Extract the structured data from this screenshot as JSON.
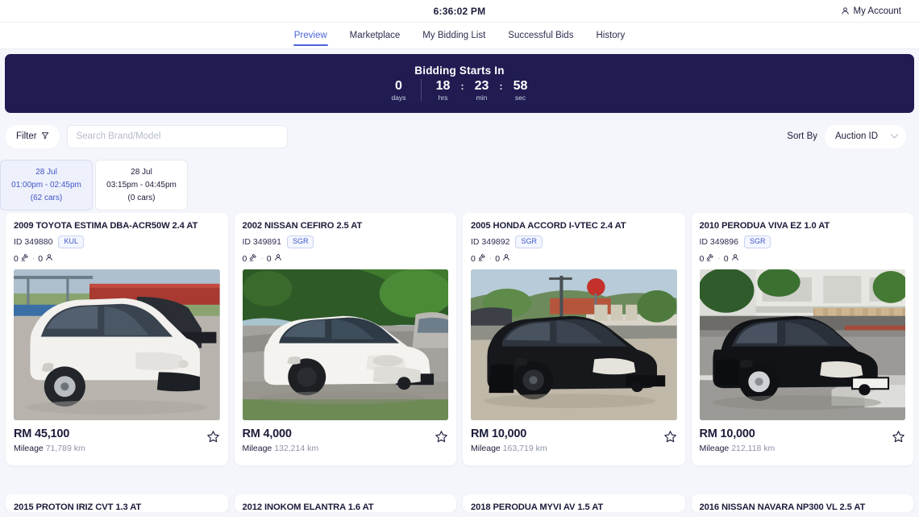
{
  "header": {
    "clock": "6:36:02 PM",
    "account_label": "My Account",
    "account_icon": "person-icon"
  },
  "nav": {
    "items": [
      {
        "label": "Preview",
        "active": true
      },
      {
        "label": "Marketplace",
        "active": false
      },
      {
        "label": "My Bidding List",
        "active": false
      },
      {
        "label": "Successful Bids",
        "active": false
      },
      {
        "label": "History",
        "active": false
      }
    ]
  },
  "countdown": {
    "title": "Bidding Starts In",
    "days": "0",
    "days_label": "days",
    "hrs": "18",
    "hrs_label": "hrs",
    "min": "23",
    "min_label": "min",
    "sec": "58",
    "sec_label": "sec",
    "separator": ":",
    "background": "#201c52"
  },
  "toolbar": {
    "filter_label": "Filter",
    "filter_icon": "funnel-icon",
    "search_placeholder": "Search Brand/Model",
    "search_value": "",
    "sort_label": "Sort By",
    "sort_value": "Auction ID",
    "sort_options": [
      "Auction ID"
    ],
    "chevron_icon": "chevron-down-icon"
  },
  "sessions": [
    {
      "date": "28 Jul",
      "time": "01:00pm - 02:45pm",
      "cars": "(62 cars)",
      "active": true
    },
    {
      "date": "28 Jul",
      "time": "03:15pm - 04:45pm",
      "cars": "(0 cars)",
      "active": false
    }
  ],
  "cards": [
    {
      "title": "2009 TOYOTA ESTIMA DBA-ACR50W 2.4 AT",
      "id": "ID 349880",
      "location": "KUL",
      "bids": "0",
      "watchers": "0",
      "price": "RM 45,100",
      "mileage_label": "Mileage",
      "mileage_value": "71,789 km",
      "photo": "white-mpv-toyota-estima",
      "favorite": false
    },
    {
      "title": "2002 NISSAN CEFIRO 2.5 AT",
      "id": "ID 349891",
      "location": "SGR",
      "bids": "0",
      "watchers": "0",
      "price": "RM 4,000",
      "mileage_label": "Mileage",
      "mileage_value": "132,214 km",
      "photo": "white-sedan-nissan-cefiro",
      "favorite": false
    },
    {
      "title": "2005 HONDA ACCORD I-VTEC 2.4 AT",
      "id": "ID 349892",
      "location": "SGR",
      "bids": "0",
      "watchers": "0",
      "price": "RM 10,000",
      "mileage_label": "Mileage",
      "mileage_value": "163,719 km",
      "photo": "black-sedan-honda-accord",
      "favorite": false
    },
    {
      "title": "2010 PERODUA VIVA EZ 1.0 AT",
      "id": "ID 349896",
      "location": "SGR",
      "bids": "0",
      "watchers": "0",
      "price": "RM 10,000",
      "mileage_label": "Mileage",
      "mileage_value": "212,118 km",
      "photo": "black-hatchback-perodua-viva",
      "favorite": false
    }
  ],
  "cards_next_row": [
    {
      "title": "2015 PROTON IRIZ CVT 1.3 AT"
    },
    {
      "title": "2012 INOKOM ELANTRA 1.6 AT"
    },
    {
      "title": "2018 PERODUA MYVI AV 1.5 AT"
    },
    {
      "title": "2016 NISSAN NAVARA NP300 VL 2.5 AT"
    }
  ],
  "icons": {
    "bid_icon": "gavel-icon",
    "watcher_icon": "person-icon",
    "favorite_icon": "star-outline-icon"
  }
}
